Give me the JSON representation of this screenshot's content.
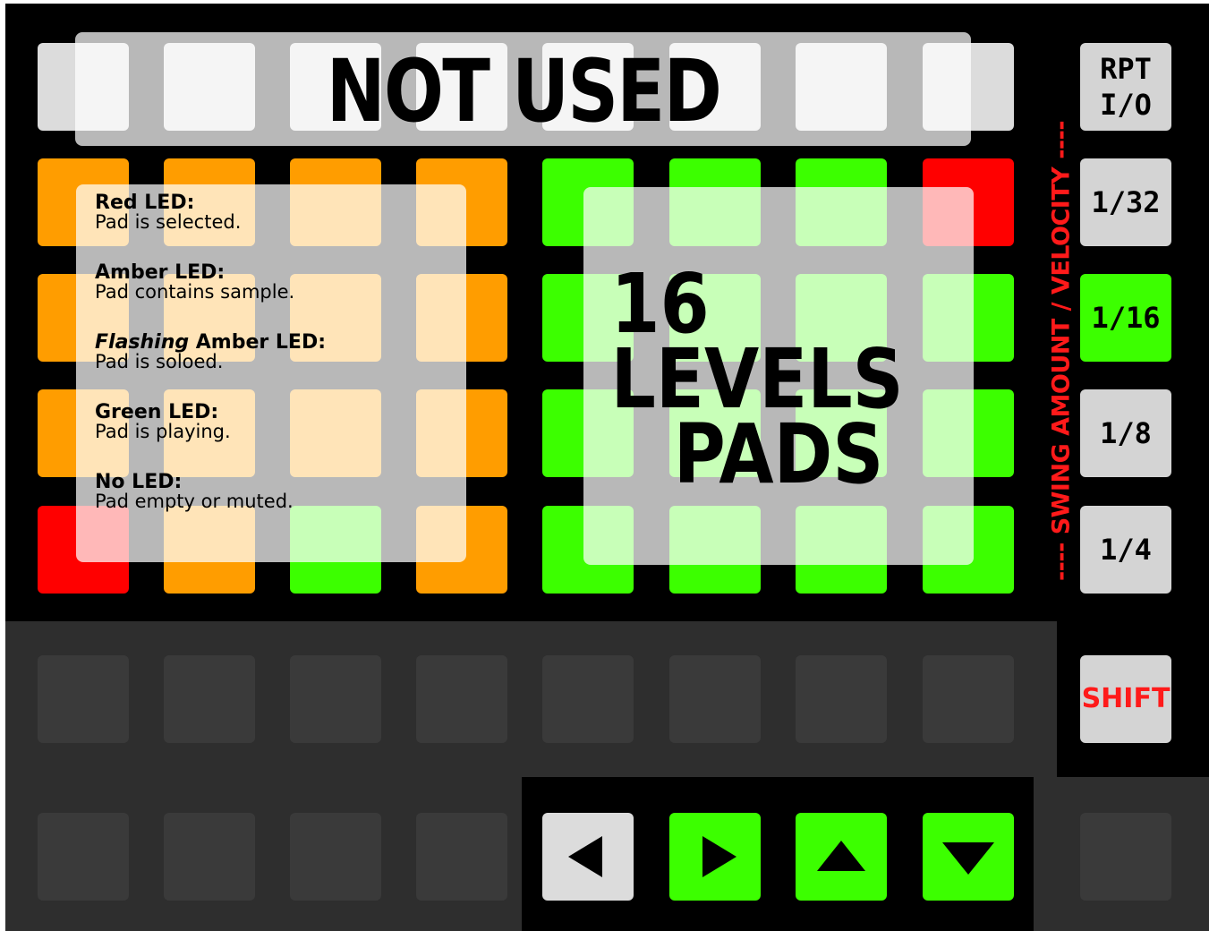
{
  "overlays": {
    "not_used": "NOT USED",
    "levels_line1": "16 LEVELS",
    "levels_line2": "PADS"
  },
  "legend": [
    {
      "title_prefix": "",
      "title": "Red LED:",
      "desc": "Pad is selected."
    },
    {
      "title_prefix": "",
      "title": "Amber LED:",
      "desc": "Pad contains sample."
    },
    {
      "title_prefix": "Flashing",
      "title": " Amber LED:",
      "desc": "Pad is soloed."
    },
    {
      "title_prefix": "",
      "title": "Green LED:",
      "desc": "Pad is playing."
    },
    {
      "title_prefix": "",
      "title": "No LED:",
      "desc": "Pad empty or muted."
    }
  ],
  "side_buttons": {
    "rpt": "RPT\nI/O",
    "b32": "1/32",
    "b16": "1/16",
    "b8": "1/8",
    "b4": "1/4",
    "shift": "SHIFT"
  },
  "vertical_label": "---- SWING AMOUNT / VELOCITY ----",
  "pad_grid": [
    [
      "orange",
      "orange",
      "orange",
      "orange",
      "green",
      "green",
      "green",
      "red"
    ],
    [
      "orange",
      "orange",
      "orange",
      "orange",
      "green",
      "green",
      "green",
      "green"
    ],
    [
      "orange",
      "orange",
      "orange",
      "orange",
      "green",
      "green",
      "green",
      "green"
    ],
    [
      "red",
      "orange",
      "green",
      "orange",
      "green",
      "green",
      "green",
      "green"
    ]
  ],
  "nav_arrows": [
    {
      "name": "left-arrow-button",
      "dir": "left",
      "active": false
    },
    {
      "name": "right-arrow-button",
      "dir": "right",
      "active": true
    },
    {
      "name": "up-arrow-button",
      "dir": "up",
      "active": true
    },
    {
      "name": "down-arrow-button",
      "dir": "down",
      "active": true
    }
  ],
  "colors": {
    "orange": "#ff9d00",
    "green": "#3cff00",
    "red": "#ff0000",
    "light_gray": "#d4d4d4",
    "dark_pad": "#3a3a3a",
    "panel_dark": "#2e2e2e",
    "label_red": "#ff1a1a"
  }
}
